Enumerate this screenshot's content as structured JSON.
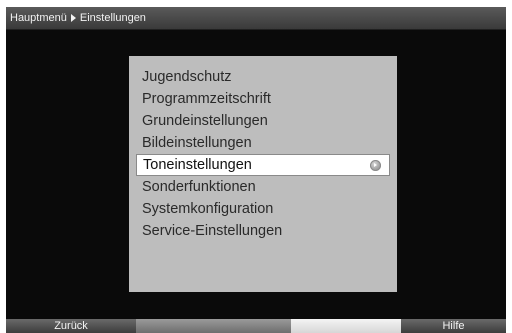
{
  "header": {
    "breadcrumb": [
      "Hauptmenü",
      "Einstellungen"
    ]
  },
  "menu": {
    "items": [
      {
        "label": "Jugendschutz",
        "selected": false
      },
      {
        "label": "Programmzeitschrift",
        "selected": false
      },
      {
        "label": "Grundeinstellungen",
        "selected": false
      },
      {
        "label": "Bildeinstellungen",
        "selected": false
      },
      {
        "label": "Toneinstellungen",
        "selected": true
      },
      {
        "label": "Sonderfunktionen",
        "selected": false
      },
      {
        "label": "Systemkonfiguration",
        "selected": false
      },
      {
        "label": "Service-Einstellungen",
        "selected": false
      }
    ],
    "selected_icon": "submenu-arrow-icon"
  },
  "footer": {
    "keys": [
      {
        "label": "Zurück",
        "color": "red"
      },
      {
        "label": "",
        "color": "green"
      },
      {
        "label": "",
        "color": "yellow"
      },
      {
        "label": "Hilfe",
        "color": "blue"
      }
    ]
  },
  "colors": {
    "background": "#0a0a0a",
    "menu_panel": "#bdbdbd",
    "selected_row": "#ffffff",
    "title_bar": "#4a4a4a"
  }
}
